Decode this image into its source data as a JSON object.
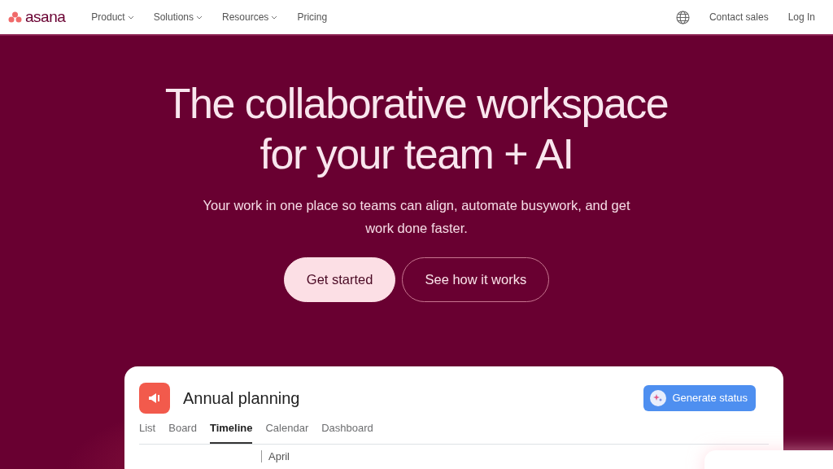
{
  "nav": {
    "logo": "asana",
    "menu": [
      {
        "label": "Product",
        "dropdown": true
      },
      {
        "label": "Solutions",
        "dropdown": true
      },
      {
        "label": "Resources",
        "dropdown": true
      },
      {
        "label": "Pricing",
        "dropdown": false
      }
    ],
    "contact": "Contact sales",
    "login": "Log In"
  },
  "hero": {
    "title_lines": [
      "The collaborative workspace",
      "for your team + AI"
    ],
    "subtitle": "Your work in one place so teams can align, automate busywork, and get work done faster.",
    "buttons": [
      {
        "label": "Get started",
        "kind": "primary"
      },
      {
        "label": "See how it works",
        "kind": "outline"
      }
    ]
  },
  "project": {
    "title": "Annual planning",
    "action": "Generate status",
    "tabs": [
      {
        "label": "List",
        "selected": false
      },
      {
        "label": "Board",
        "selected": false
      },
      {
        "label": "Timeline",
        "selected": true
      },
      {
        "label": "Calendar",
        "selected": false
      },
      {
        "label": "Dashboard",
        "selected": false
      }
    ],
    "month": "April"
  }
}
